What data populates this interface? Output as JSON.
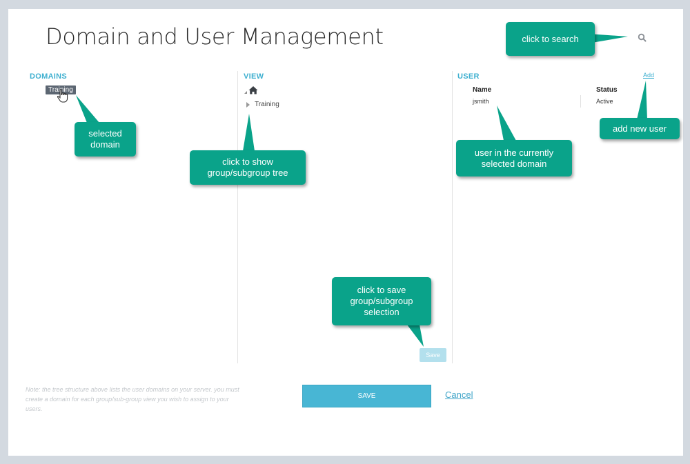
{
  "page": {
    "title": "Domain and User Management"
  },
  "domains": {
    "heading": "DOMAINS",
    "items": [
      "Training"
    ]
  },
  "view": {
    "heading": "VIEW",
    "tree": [
      {
        "label": "Training"
      }
    ],
    "save_label": "Save"
  },
  "user": {
    "heading": "USER",
    "add_label": "Add",
    "columns": [
      "Name",
      "Status"
    ],
    "rows": [
      {
        "name": "jsmith",
        "status": "Active"
      }
    ]
  },
  "footer": {
    "note": "Note: the tree structure above lists the user domains on your server.  you must create a domain for each group/sub-group view you wish to assign to your users.",
    "save_label": "SAVE",
    "cancel_label": "Cancel"
  },
  "callouts": {
    "search": "click to search",
    "selected_domain": "selected domain",
    "show_tree": "click to show group/subgroup tree",
    "user_in_domain": "user in the currently selected domain",
    "add_user": "add new user",
    "save_selection": "click to save group/subgroup selection"
  },
  "colors": {
    "accent": "#3fb0d0",
    "callout": "#0aa38a",
    "selected_domain_bg": "#5c6672",
    "background": "#d3d9e0"
  }
}
